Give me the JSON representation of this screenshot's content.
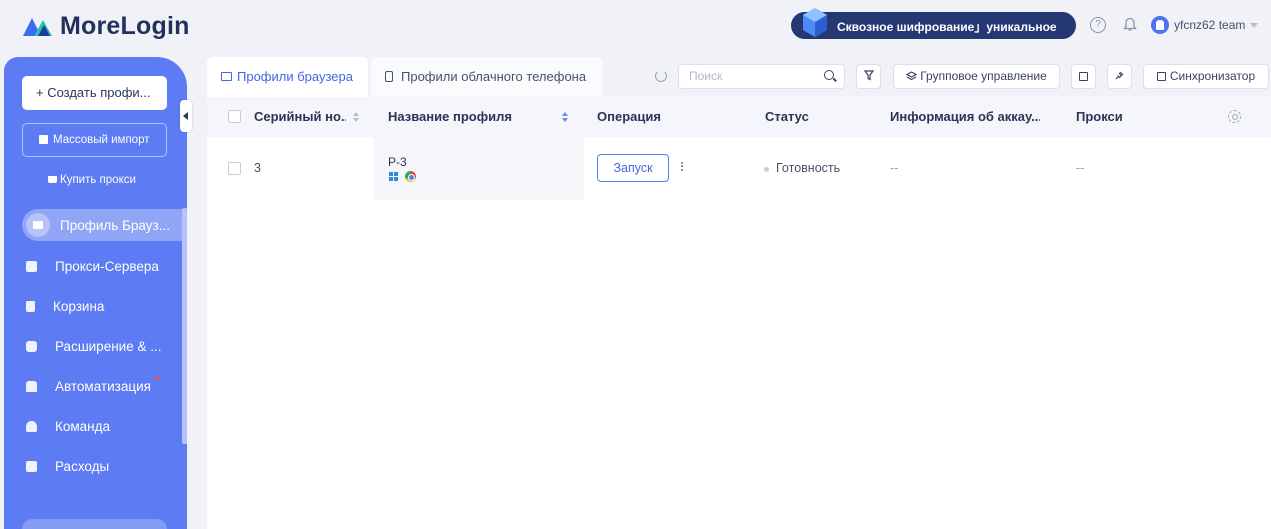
{
  "header": {
    "logo_text": "MoreLogin",
    "promo_text": "Сквозное шифрование」уникальное",
    "help_icon": "?",
    "user_name": "yfcnz62 team"
  },
  "sidebar": {
    "create_button": "+ Создать профи...",
    "import_button": "Массовый импорт",
    "buy_proxy": "Купить прокси",
    "items": [
      {
        "label": "Профиль Брауз...",
        "icon": "browser-profile-icon",
        "active": true
      },
      {
        "label": "Прокси-Сервера",
        "icon": "proxy-server-icon"
      },
      {
        "label": "Корзина",
        "icon": "trash-icon"
      },
      {
        "label": "Расширение & ...",
        "icon": "puzzle-icon"
      },
      {
        "label": "Автоматизация",
        "icon": "robot-icon",
        "badge": true
      },
      {
        "label": "Команда",
        "icon": "team-icon"
      },
      {
        "label": "Расходы",
        "icon": "wallet-icon"
      }
    ]
  },
  "tabs": [
    {
      "label": "Профили браузера",
      "active": true
    },
    {
      "label": "Профили облачного телефона",
      "active": false
    }
  ],
  "toolbar": {
    "search_placeholder": "Поиск",
    "group_manage": "Групповое управление",
    "synchronizer": "Синхронизатор"
  },
  "table": {
    "columns": [
      "Серийный но...",
      "Название профиля",
      "Операция",
      "Статус",
      "Информация об аккау...",
      "Прокси"
    ],
    "rows": [
      {
        "serial": "3",
        "name": "P-3",
        "operation": "Запуск",
        "status": "Готовность",
        "account_info": "--",
        "proxy": "--"
      }
    ]
  },
  "colors": {
    "sidebar": "#5d7bf2",
    "accent": "#4465e6",
    "promo_bg": "#263874",
    "logo_text": "#24315e"
  }
}
